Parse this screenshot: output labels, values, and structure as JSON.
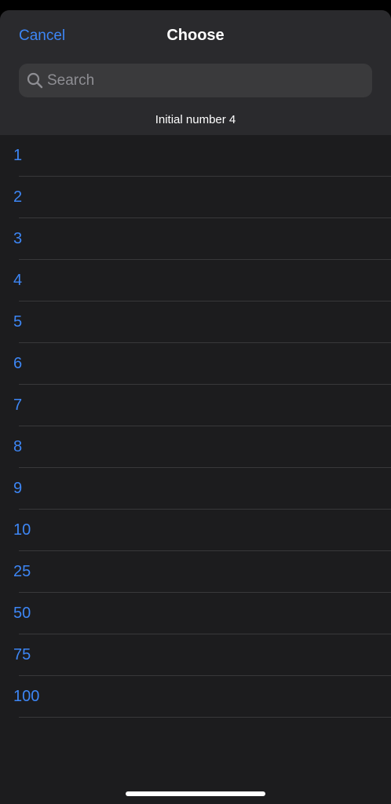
{
  "header": {
    "cancel_label": "Cancel",
    "title": "Choose",
    "search_placeholder": "Search",
    "subtitle": "Initial number 4"
  },
  "options": [
    "1",
    "2",
    "3",
    "4",
    "5",
    "6",
    "7",
    "8",
    "9",
    "10",
    "25",
    "50",
    "75",
    "100"
  ],
  "colors": {
    "accent": "#3d86f5",
    "background": "#1c1c1e",
    "header_background": "#2a2a2d",
    "search_field": "#3a3a3c"
  }
}
